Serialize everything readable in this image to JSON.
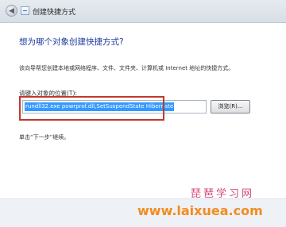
{
  "window": {
    "title": "创建快捷方式"
  },
  "header": {
    "heading": "想为哪个对象创建快捷方式?"
  },
  "description": "该向导帮您创建本地或网络程序、文件、文件夹、计算机或 Internet 地址的快捷方式。",
  "location": {
    "label": "请键入对象的位置(T):",
    "value": "rundll32.exe powrprof.dll,SetSuspendState Hibernate"
  },
  "browse_label": "浏览(R)...",
  "hint": "单击“下一步”继续。",
  "watermark": {
    "chinese": "琵琶学习网",
    "url": "www.laixuea.com"
  },
  "colors": {
    "heading": "#1e3d9c",
    "selection": "#3399ff",
    "highlight_box": "#c0392b",
    "watermark_url": "#f28c1f"
  },
  "icons": {
    "back": "back-arrow-icon",
    "wizard": "shortcut-wizard-icon"
  }
}
